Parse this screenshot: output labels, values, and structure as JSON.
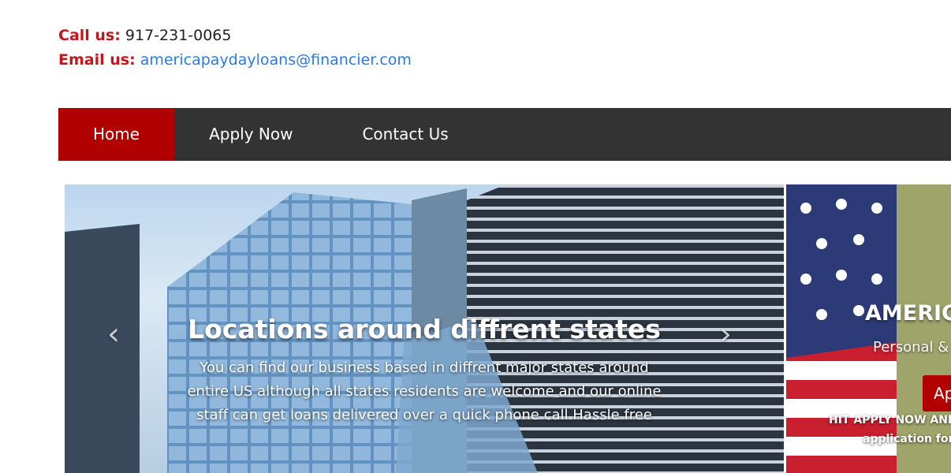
{
  "contact": {
    "call_label": "Call us:",
    "phone": "917-231-0065",
    "email_label": "Email us:",
    "email": "americapaydayloans@financier.com"
  },
  "nav": {
    "items": [
      {
        "label": "Home"
      },
      {
        "label": "Apply Now"
      },
      {
        "label": "Contact Us"
      }
    ]
  },
  "carousel": {
    "slide1": {
      "title": "Locations around diffrent states",
      "text": "You can find our business based in diffrent major states around entire US although all states residents are welcome and our online staff can get loans delivered over a quick phone call.Hassle free"
    },
    "slide2": {
      "title": "AMERIC",
      "subtitle": "Personal &",
      "button": "Ap",
      "hit_text": "HIT APPLY NOW ANI",
      "app_text": "application for"
    },
    "prev_glyph": "‹",
    "next_glyph": "›"
  }
}
